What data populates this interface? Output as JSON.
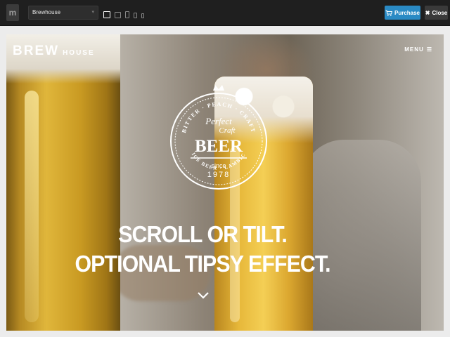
{
  "toolbar": {
    "logo_letter": "m",
    "theme_name": "Brewhouse",
    "theme_caret": "▾",
    "devices": [
      "desktop-icon",
      "laptop-icon",
      "tablet-icon",
      "tablet-small-icon",
      "phone-icon"
    ],
    "purchase_label": "Purchase",
    "close_label": "Close",
    "close_glyph": "✖",
    "accent": "#2a8ac4"
  },
  "site": {
    "logo_brew": "BREW",
    "logo_house": "HOUSE",
    "menu_label": "MENU",
    "menu_glyph": "☰",
    "badge": {
      "top_words": "BITTER · PEACH · CRAFT",
      "left_words": "PILSNER · DUNKEL",
      "right_words": "TOFFEE · STOUT",
      "bottom_words": "ICE BEER · LAMBIC",
      "script_line1": "Perfect",
      "script_line2": "Craft",
      "word": "BEER",
      "since": "since",
      "year": "1978"
    },
    "hero_line1": "SCROLL OR TILT.",
    "hero_line2": "OPTIONAL TIPSY EFFECT."
  }
}
